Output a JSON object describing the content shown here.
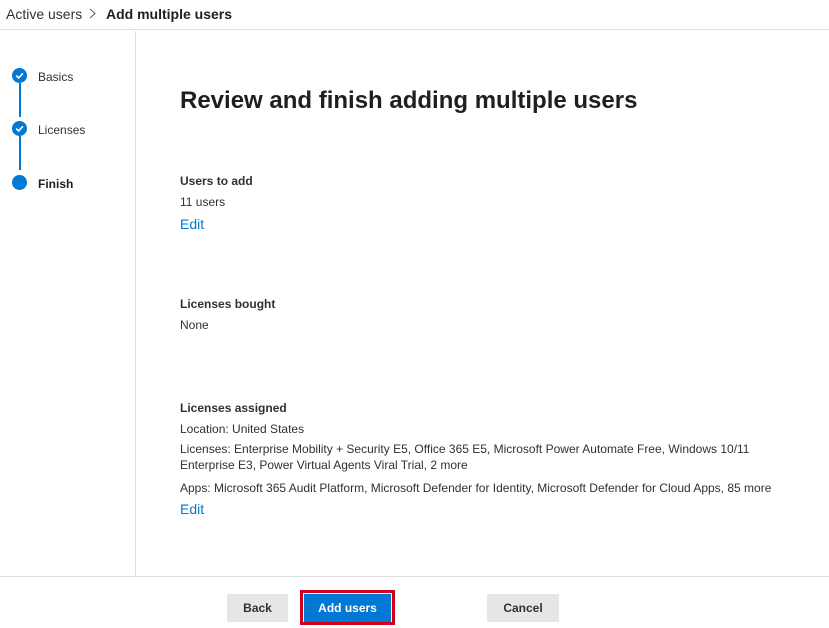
{
  "breadcrumb": {
    "parent": "Active users",
    "current": "Add multiple users"
  },
  "steps": [
    {
      "label": "Basics",
      "state": "completed",
      "icon": "checkmark-icon"
    },
    {
      "label": "Licenses",
      "state": "completed",
      "icon": "checkmark-icon"
    },
    {
      "label": "Finish",
      "state": "current",
      "icon": "dot-icon"
    }
  ],
  "page": {
    "title": "Review and finish adding multiple users"
  },
  "sections": {
    "users_to_add": {
      "label": "Users to add",
      "value": "11 users",
      "edit": "Edit"
    },
    "licenses_bought": {
      "label": "Licenses bought",
      "value": "None"
    },
    "licenses_assigned": {
      "label": "Licenses assigned",
      "location": "Location: United States",
      "licenses": "Licenses: Enterprise Mobility + Security E5, Office 365 E5, Microsoft Power Automate Free, Windows 10/11 Enterprise E3, Power Virtual Agents Viral Trial, 2 more",
      "apps": "Apps: Microsoft 365 Audit Platform, Microsoft Defender for Identity, Microsoft Defender for Cloud Apps, 85 more",
      "edit": "Edit"
    }
  },
  "footer": {
    "back": "Back",
    "add_users": "Add users",
    "cancel": "Cancel"
  },
  "colors": {
    "accent": "#0078d4",
    "highlight": "#d0021b",
    "secondary_button": "#e6e6e6"
  }
}
